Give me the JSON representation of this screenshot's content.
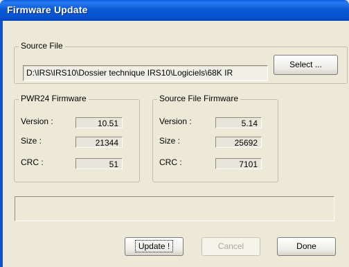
{
  "window": {
    "title": "Firmware Update"
  },
  "source_file": {
    "legend": "Source File",
    "path": "D:\\IRS\\IRS10\\Dossier technique IRS10\\Logiciels\\68K IR",
    "select_label": "Select ..."
  },
  "pwr24": {
    "legend": "PWR24 Firmware",
    "version_label": "Version :",
    "version": "10.51",
    "size_label": "Size :",
    "size": "21344",
    "crc_label": "CRC :",
    "crc": "51"
  },
  "source_fw": {
    "legend": "Source File Firmware",
    "version_label": "Version :",
    "version": "5.14",
    "size_label": "Size :",
    "size": "25692",
    "crc_label": "CRC :",
    "crc": "7101"
  },
  "status": {
    "text": ""
  },
  "buttons": {
    "update": "Update !",
    "cancel": "Cancel",
    "done": "Done"
  }
}
